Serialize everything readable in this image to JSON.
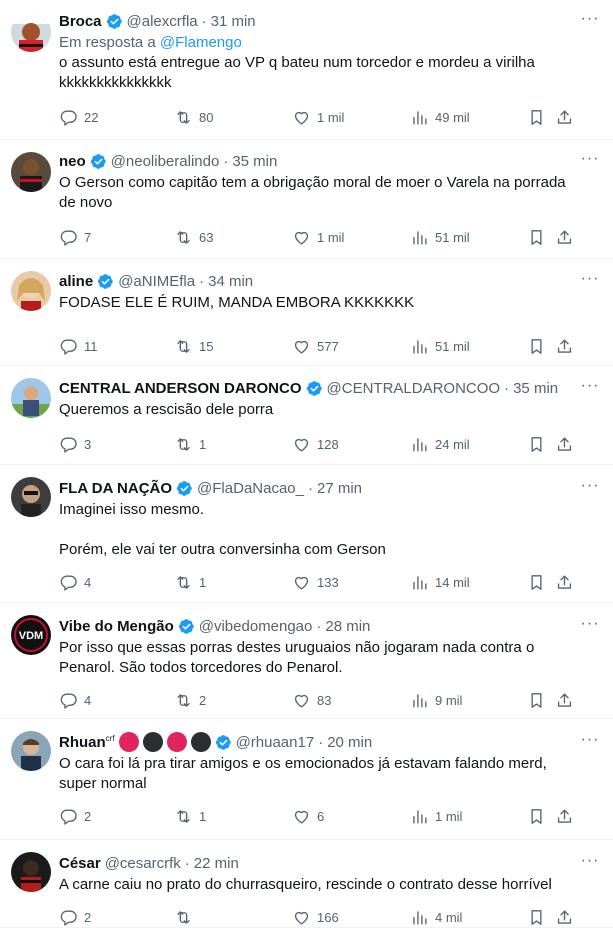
{
  "icons": {
    "more": "more-icon",
    "verified": "verified-badge-icon",
    "reply": "reply-icon",
    "retweet": "retweet-icon",
    "like": "like-icon",
    "views": "views-icon",
    "bookmark": "bookmark-icon",
    "share": "share-icon"
  },
  "colors": {
    "accent": "#1d9bf0",
    "text": "#0f1419",
    "muted": "#536471"
  },
  "more_glyph": "···",
  "dot": "·",
  "tweets": [
    {
      "name": "Broca",
      "handle": "@alexcrfla",
      "time": "31 min",
      "reply_prefix": "Em resposta a ",
      "reply_to": "@Flamengo",
      "text": "o assunto está entregue ao VP q bateu num torcedor e mordeu a virilha\nkkkkkkkkkkkkkkk",
      "replies": "22",
      "retweets": "80",
      "likes": "1 mil",
      "views": "49 mil"
    },
    {
      "name": "neo",
      "handle": "@neoliberalindo",
      "time": "35 min",
      "text": "O Gerson como capitão tem a obrigação moral de moer o Varela na porrada\nde novo",
      "replies": "7",
      "retweets": "63",
      "likes": "1 mil",
      "views": "51 mil"
    },
    {
      "name": "aline",
      "handle": "@aNIMEfla",
      "time": "34 min",
      "text": "FODASE ELE É RUIM, MANDA EMBORA KKKKKKK",
      "replies": "11",
      "retweets": "15",
      "likes": "577",
      "views": "51 mil"
    },
    {
      "name": "CENTRAL ANDERSON DARONCO",
      "handle": "@CENTRALDARONCOO",
      "time": "35 min",
      "text": "Queremos a rescisão dele porra",
      "replies": "3",
      "retweets": "1",
      "likes": "128",
      "views": "24 mil"
    },
    {
      "name": "FLA DA NAÇÃO",
      "handle": "@FlaDaNacao_",
      "time": "27 min",
      "text": "Imaginei isso mesmo.\n\nPorém, ele vai ter outra conversinha com Gerson",
      "replies": "4",
      "retweets": "1",
      "likes": "133",
      "views": "14 mil"
    },
    {
      "name": "Vibe do Mengão",
      "handle": "@vibedomengao",
      "time": "28 min",
      "text": "Por isso que essas porras destes uruguaios não jogaram nada contra o\nPenarol. São todos torcedores do Penarol.",
      "replies": "4",
      "retweets": "2",
      "likes": "83",
      "views": "9 mil"
    },
    {
      "name": "Rhuan",
      "name_sup": "crf",
      "handle": "@rhuaan17",
      "time": "20 min",
      "text": "O cara foi lá pra tirar amigos e os emocionados já estavam falando merd,\nsuper normal",
      "replies": "2",
      "retweets": "1",
      "likes": "6",
      "views": "1 mil"
    },
    {
      "name": "César",
      "handle": "@cesarcrfk",
      "time": "22 min",
      "text": "A carne caiu no prato do churrasqueiro, rescinde o contrato desse horrível",
      "replies": "2",
      "retweets": "",
      "likes": "166",
      "views": "4 mil"
    }
  ]
}
